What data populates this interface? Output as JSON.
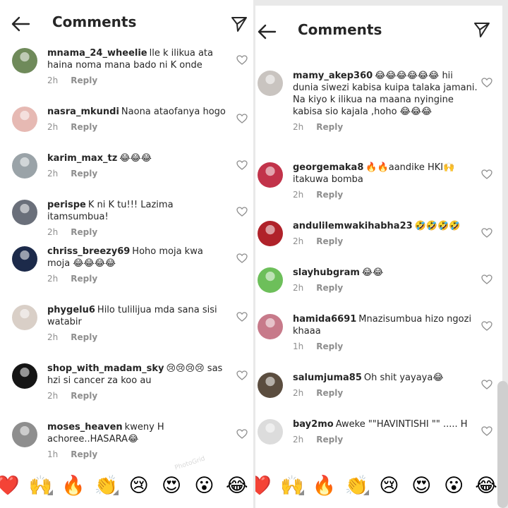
{
  "left": {
    "title": "Comments",
    "comments": [
      {
        "user": "mnama_24_wheelie",
        "text": "lle k ilikua ata haina noma mana bado ni K onde",
        "time": "2h",
        "reply": "Reply",
        "avatar": "#6f8a5a"
      },
      {
        "user": "nasra_mkundi",
        "text": "Naona ataofanya hogo",
        "time": "2h",
        "reply": "Reply",
        "avatar": "#e6b9b3"
      },
      {
        "user": "karim_max_tz",
        "text": "😂😂😂",
        "time": "2h",
        "reply": "Reply",
        "avatar": "#9aa3a8"
      },
      {
        "user": "perispe",
        "text": "K ni K tu!!! Lazima itamsumbua!",
        "time": "2h",
        "reply": "Reply",
        "avatar": "#6a6f7a"
      },
      {
        "user": "chriss_breezy69",
        "text": "Hoho moja kwa moja 😂😂😂😂",
        "time": "2h",
        "reply": "Reply",
        "avatar": "#1c2a4a"
      },
      {
        "user": "phygelu6",
        "text": "Hilo tulilijua mda sana  sisi watabir",
        "time": "2h",
        "reply": "Reply",
        "avatar": "#d9cfc7"
      },
      {
        "user": "shop_with_madam_sky",
        "text": "😢😢😢😢 sas hzi si cancer za koo au",
        "time": "2h",
        "reply": "Reply",
        "avatar": "#151515"
      },
      {
        "user": "moses_heaven",
        "text": "kweny H achoree..HASARA😂",
        "time": "1h",
        "reply": "Reply",
        "avatar": "#8e8e8e"
      }
    ],
    "reactions": [
      "❤️",
      "🙌",
      "🔥",
      "👏",
      "😢",
      "😍",
      "😮",
      "😂"
    ]
  },
  "right": {
    "title": "Comments",
    "comments": [
      {
        "user": "mamy_akep360",
        "text": "😂😂😂😂😂😂 hii dunia siwezi kabisa kuipa talaka jamani. Na kiyo k ilikua na maana nyingine kabisa sio kajala ,hoho 😂😂😂",
        "time": "2h",
        "reply": "Reply",
        "avatar": "#c9c4c0"
      },
      {
        "user": "georgemaka8",
        "text": "🔥🔥aandike  HKI🙌 itakuwa bomba",
        "time": "2h",
        "reply": "Reply",
        "avatar": "#c2334a"
      },
      {
        "user": "andulilemwakihabha23",
        "text": "🤣🤣🤣🤣",
        "time": "2h",
        "reply": "Reply",
        "avatar": "#b0222a"
      },
      {
        "user": "slayhubgram",
        "text": "😂😂",
        "time": "2h",
        "reply": "Reply",
        "avatar": "#6dbf5a"
      },
      {
        "user": "hamida6691",
        "text": "Mnazisumbua hizo ngozi khaaa",
        "time": "1h",
        "reply": "Reply",
        "avatar": "#c77a8a"
      },
      {
        "user": "salumjuma85",
        "text": "Oh shit yayaya😂",
        "time": "2h",
        "reply": "Reply",
        "avatar": "#5b4d3f"
      },
      {
        "user": "bay2mo",
        "text": "Aweke \"\"HAVINTISHI \"\" ..... H",
        "time": "2h",
        "reply": "Reply",
        "avatar": "#dcdcdc"
      }
    ],
    "reactions": [
      "❤️",
      "🙌",
      "🔥",
      "👏",
      "😢",
      "😍",
      "😮",
      "😂"
    ]
  },
  "watermark": "PhotoGrid"
}
